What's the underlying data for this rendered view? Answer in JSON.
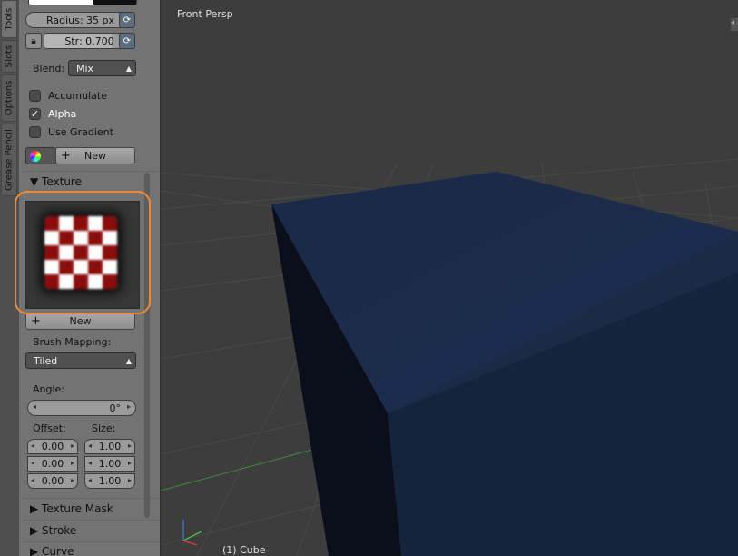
{
  "tabs": [
    "Tools",
    "Slots",
    "Options",
    "Grease Pencil"
  ],
  "brush": {
    "radius_label": "Radius:",
    "radius_value": "35 px",
    "strength_label": "Str:",
    "strength_value": "0.700",
    "blend_label": "Blend:",
    "blend_value": "Mix",
    "accumulate_label": "Accumulate",
    "alpha_label": "Alpha",
    "use_gradient_label": "Use Gradient",
    "new_label": "New"
  },
  "texture": {
    "header": "Texture",
    "new_label": "New",
    "brush_mapping_label": "Brush Mapping:",
    "brush_mapping_value": "Tiled",
    "angle_label": "Angle:",
    "angle_value": "0°",
    "offset_label": "Offset:",
    "size_label": "Size:",
    "offset": [
      "0.00",
      "0.00",
      "0.00"
    ],
    "size": [
      "1.00",
      "1.00",
      "1.00"
    ]
  },
  "sections": {
    "texture_mask": "Texture Mask",
    "stroke": "Stroke",
    "curve": "Curve"
  },
  "viewport": {
    "view_label": "Front Persp",
    "object_label": "(1) Cube"
  },
  "checkboxes": {
    "accumulate": false,
    "alpha": true,
    "use_gradient": false
  }
}
